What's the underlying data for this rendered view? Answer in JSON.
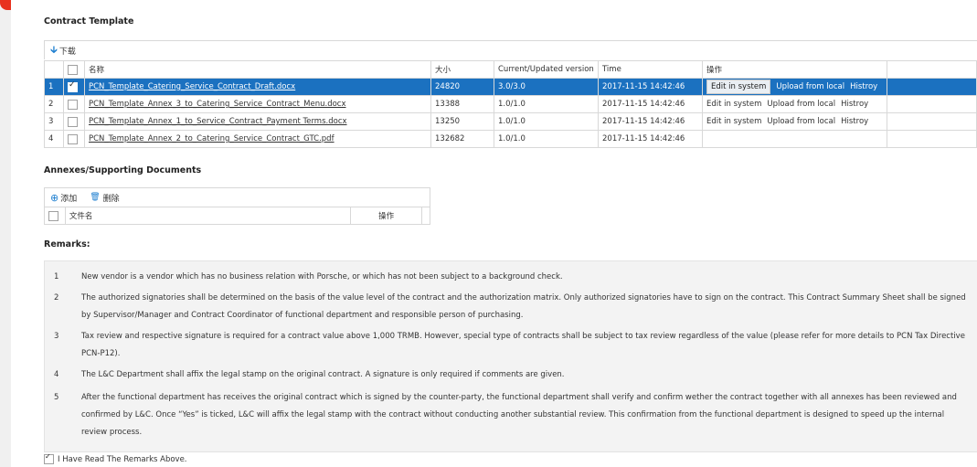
{
  "contract_template": {
    "title": "Contract Template",
    "download_label": "下载",
    "columns": {
      "name": "名称",
      "size": "大小",
      "version": "Current/Updated version",
      "time": "Time",
      "ops": "操作"
    },
    "rows": [
      {
        "num": "1",
        "checked": true,
        "name": "PCN_Template_Catering_Service_Contract_Draft.docx",
        "size": "24820",
        "version": "3.0/3.0",
        "time": "2017-11-15 14:42:46",
        "ops": [
          "Edit in system",
          "Upload from local",
          "Histroy"
        ]
      },
      {
        "num": "2",
        "checked": false,
        "name": "PCN_Template_Annex_3_to_Catering_Service_Contract_Menu.docx",
        "size": "13388",
        "version": "1.0/1.0",
        "time": "2017-11-15 14:42:46",
        "ops": [
          "Edit in system",
          "Upload from local",
          "Histroy"
        ]
      },
      {
        "num": "3",
        "checked": false,
        "name": "PCN_Template_Annex_1_to_Service_Contract_Payment Terms.docx",
        "size": "13250",
        "version": "1.0/1.0",
        "time": "2017-11-15 14:42:46",
        "ops": [
          "Edit in system",
          "Upload from local",
          "Histroy"
        ]
      },
      {
        "num": "4",
        "checked": false,
        "name": "PCN_Template_Annex_2_to_Catering_Service_Contract_GTC.pdf",
        "size": "132682",
        "version": "1.0/1.0",
        "time": "2017-11-15 14:42:46",
        "ops": []
      }
    ]
  },
  "annexes": {
    "title": "Annexes/Supporting Documents",
    "add_label": "添加",
    "delete_label": "删除",
    "col_filename": "文件名",
    "col_ops": "操作"
  },
  "remarks": {
    "title": "Remarks:",
    "items": [
      {
        "num": "1",
        "text": "New vendor is a vendor which has no business relation with Porsche, or which has not been subject to a background check."
      },
      {
        "num": "2",
        "text": "The authorized signatories shall be determined on the basis of the value level of the contract and the authorization matrix. Only authorized signatories have to sign on the contract. This Contract Summary Sheet shall be signed by Supervisor/Manager and Contract Coordinator of functional department and responsible person of purchasing."
      },
      {
        "num": "3",
        "text": "Tax review and respective signature is required for a contract value above 1,000 TRMB. However, special type of contracts shall be subject to tax review regardless of the value (please refer for more details to PCN Tax Directive PCN-P12)."
      },
      {
        "num": "4",
        "text": "The L&C Department shall affix the legal stamp on the original contract. A signature is only required if comments are given."
      },
      {
        "num": "5",
        "text": "After the functional department has receives the original contract which is signed by the counter-party, the functional department shall verify and confirm wether the contract together with all annexes has been reviewed and confirmed by L&C. Once “Yes” is ticked, L&C will affix the legal stamp with the contract without conducting another substantial review. This confirmation from the functional department is designed to speed up the internal review process."
      }
    ]
  },
  "acknowledge": {
    "label": "I Have Read The Remarks Above.",
    "checked": true
  },
  "colors": {
    "accent": "#1b71c0",
    "top_bar": "#e8321e",
    "icon_blue": "#1e7fd0"
  },
  "icons": {
    "download": "download-arrow-icon",
    "add": "plus-circle-icon",
    "delete": "trash-icon"
  }
}
